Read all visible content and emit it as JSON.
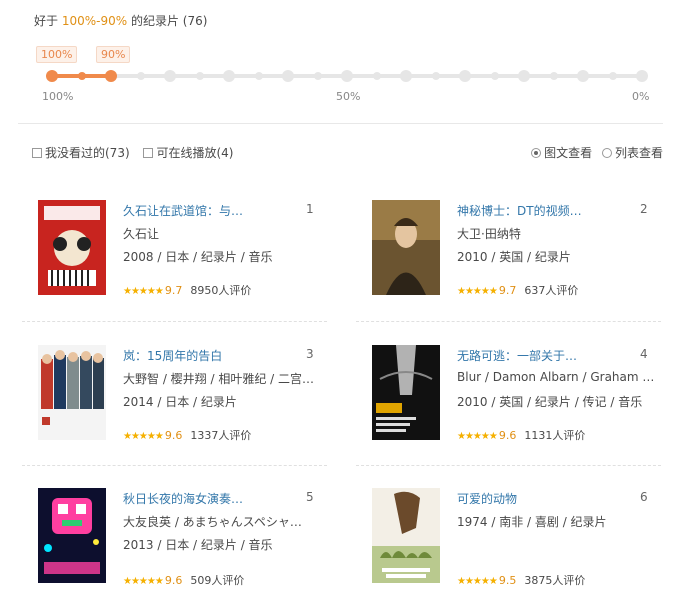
{
  "header": {
    "prefix": "好于 ",
    "range": "100%-90%",
    "suffix": " 的纪录片 (76)"
  },
  "slider": {
    "left_tag": "100%",
    "right_tag": "90%",
    "scale_left": "100%",
    "scale_mid": "50%",
    "scale_right": "0%",
    "selected_range": [
      100,
      90
    ]
  },
  "filters": {
    "unwatched": "我没看过的(73)",
    "online": "可在线播放(4)"
  },
  "views": {
    "grid": "图文查看",
    "list": "列表查看",
    "selected": "图文查看"
  },
  "colors": {
    "accent": "#f08a4b",
    "link": "#3377aa",
    "star": "#f5b000"
  },
  "movies": [
    {
      "title": "久石让在武道馆：与…",
      "rank": "1",
      "line2": "久石让",
      "line3": "2008 / 日本 / 纪录片 / 音乐",
      "stars": "★★★★★",
      "score": "9.7",
      "votes": "8950人评价"
    },
    {
      "title": "神秘博士：DT的视频…",
      "rank": "2",
      "line2": "大卫·田纳特",
      "line3": "2010 / 英国 / 纪录片",
      "stars": "★★★★★",
      "score": "9.7",
      "votes": "637人评价"
    },
    {
      "title": "岚：15周年的告白",
      "rank": "3",
      "line2": "大野智 / 樱井翔 / 相叶雅纪 / 二宫…",
      "line3": "2014 / 日本 / 纪录片",
      "stars": "★★★★★",
      "score": "9.6",
      "votes": "1337人评价"
    },
    {
      "title": "无路可逃：一部关于…",
      "rank": "4",
      "line2": "Blur / Damon Albarn / Graham …",
      "line3": "2010 / 英国 / 纪录片 / 传记 / 音乐",
      "stars": "★★★★★",
      "score": "9.6",
      "votes": "1131人评价"
    },
    {
      "title": "秋日长夜的海女演奏…",
      "rank": "5",
      "line2": "大友良英 / あまちゃんスペシャ…",
      "line3": "2013 / 日本 / 纪录片 / 音乐",
      "stars": "★★★★★",
      "score": "9.6",
      "votes": "509人评价"
    },
    {
      "title": "可爱的动物",
      "rank": "6",
      "line2": "1974 / 南非 / 喜剧 / 纪录片",
      "line3": "",
      "stars": "★★★★★",
      "score": "9.5",
      "votes": "3875人评价"
    }
  ]
}
